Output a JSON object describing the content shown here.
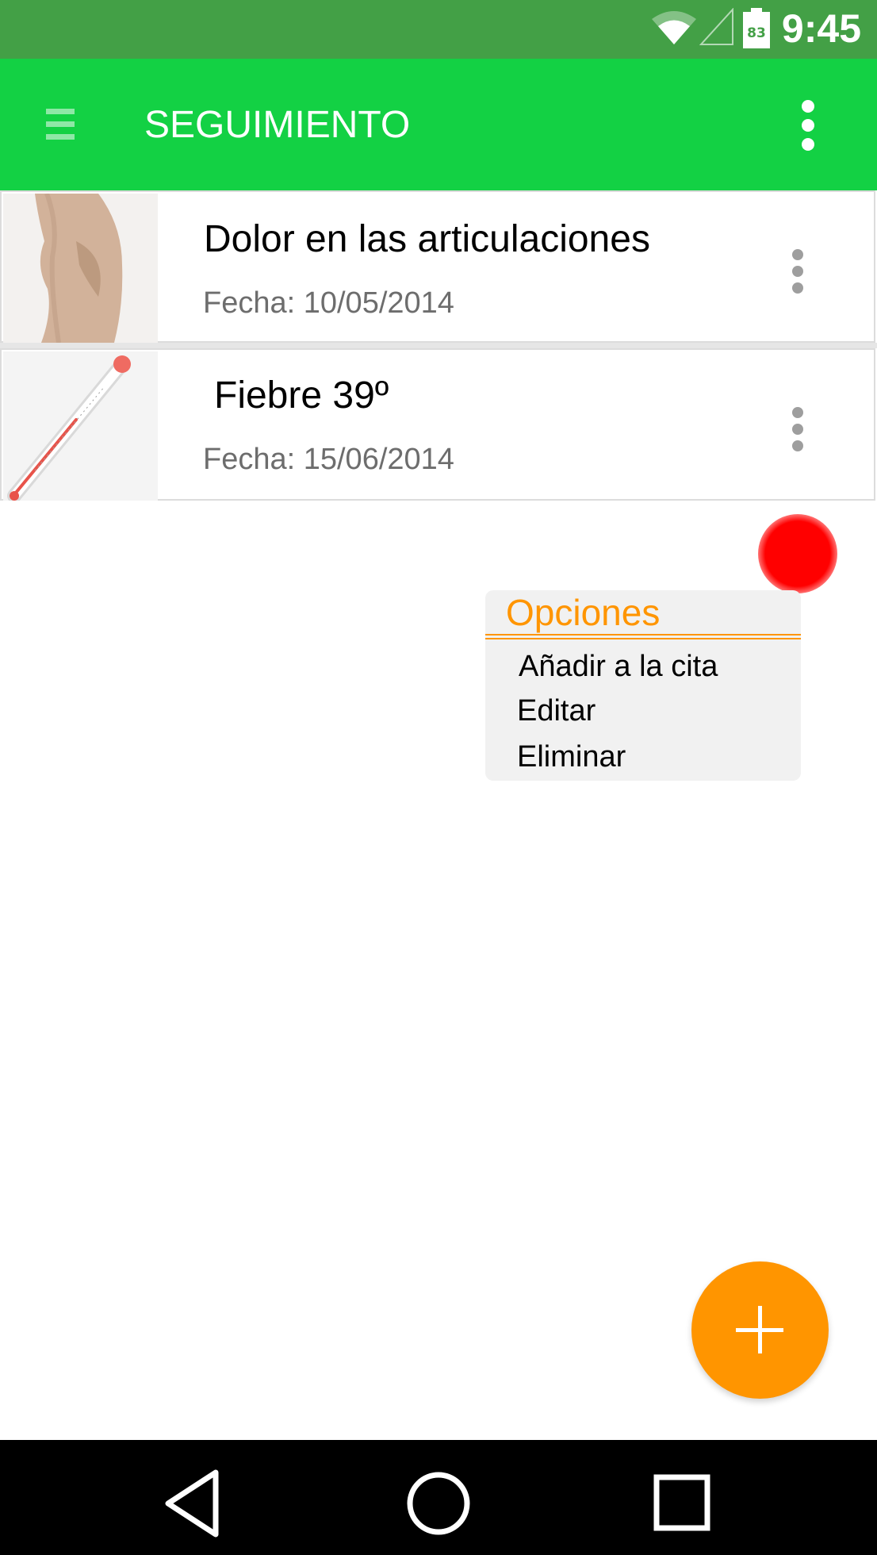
{
  "status_bar": {
    "time": "9:45",
    "battery_level": "83",
    "icons": [
      "wifi-icon",
      "signal-icon",
      "battery-icon"
    ]
  },
  "app_bar": {
    "title": "SEGUIMIENTO",
    "menu_icon": "hamburger-menu-icon",
    "overflow_icon": "overflow-menu-icon"
  },
  "items": [
    {
      "title": "Dolor en las articulaciones",
      "date": "Fecha: 10/05/2014",
      "thumbnail": "knee-thumbnail"
    },
    {
      "title": "Fiebre 39º",
      "date": "Fecha: 15/06/2014",
      "thumbnail": "thermometer-thumbnail"
    }
  ],
  "popup_menu": {
    "title": "Opciones",
    "items": [
      "Añadir a la cita",
      "Editar",
      "Eliminar"
    ]
  },
  "fab": {
    "icon": "plus-icon"
  },
  "nav_bar": {
    "icons": [
      "back-icon",
      "home-icon",
      "recents-icon"
    ]
  },
  "colors": {
    "status_bar": "#43a046",
    "app_bar": "#13d144",
    "accent": "#ff9500",
    "touch_indicator": "#ff0000",
    "date_text": "#6d6d6d"
  }
}
